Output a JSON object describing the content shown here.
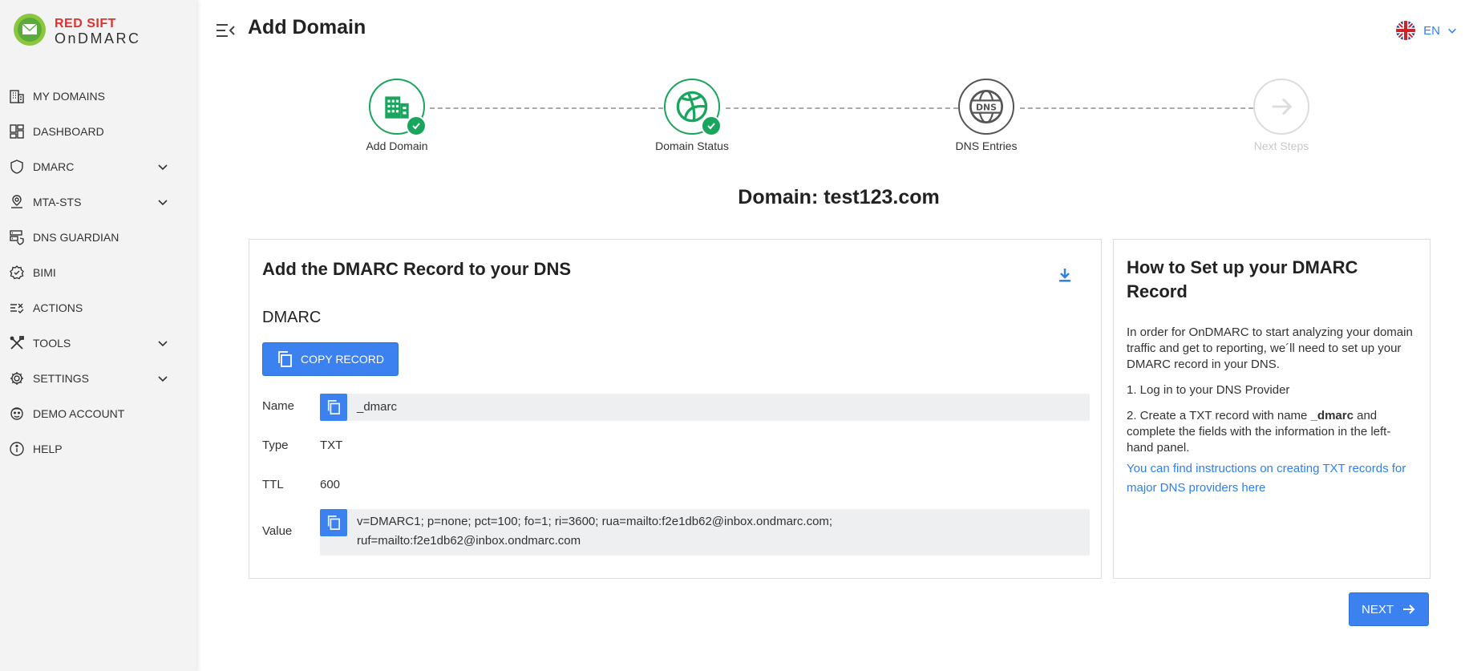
{
  "brand": {
    "line1": "RED SIFT",
    "line2": "OnDMARC"
  },
  "sidebar": {
    "items": [
      {
        "label": "MY DOMAINS",
        "icon": "building-icon"
      },
      {
        "label": "DASHBOARD",
        "icon": "dashboard-icon"
      },
      {
        "label": "DMARC",
        "icon": "shield-icon",
        "expandable": true
      },
      {
        "label": "MTA-STS",
        "icon": "map-pin-icon",
        "expandable": true
      },
      {
        "label": "DNS GUARDIAN",
        "icon": "server-shield-icon"
      },
      {
        "label": "BIMI",
        "icon": "badge-check-icon"
      },
      {
        "label": "ACTIONS",
        "icon": "checklist-icon"
      },
      {
        "label": "TOOLS",
        "icon": "tools-icon",
        "expandable": true
      },
      {
        "label": "SETTINGS",
        "icon": "gear-icon",
        "expandable": true
      },
      {
        "label": "DEMO ACCOUNT",
        "icon": "user-icon"
      },
      {
        "label": "HELP",
        "icon": "info-icon"
      }
    ]
  },
  "header": {
    "title": "Add Domain",
    "language": "EN"
  },
  "stepper": {
    "steps": [
      {
        "label": "Add Domain",
        "status": "complete"
      },
      {
        "label": "Domain Status",
        "status": "complete"
      },
      {
        "label": "DNS Entries",
        "status": "current"
      },
      {
        "label": "Next Steps",
        "status": "upcoming"
      }
    ],
    "dns_badge": "DNS"
  },
  "domain_heading": "Domain: test123.com",
  "record_card": {
    "title": "Add the DMARC Record to your DNS",
    "section": "DMARC",
    "copy_button": "COPY RECORD",
    "fields": {
      "name_label": "Name",
      "name_value": "_dmarc",
      "type_label": "Type",
      "type_value": "TXT",
      "ttl_label": "TTL",
      "ttl_value": "600",
      "value_label": "Value",
      "value_line1": "v=DMARC1; p=none; pct=100; fo=1; ri=3600; rua=mailto:f2e1db62@inbox.ondmarc.com;",
      "value_line2": "ruf=mailto:f2e1db62@inbox.ondmarc.com"
    }
  },
  "help_card": {
    "title": "How to Set up your DMARC Record",
    "intro": "In order for OnDMARC to start analyzing your domain traffic and get to reporting, we´ll need to set up your DMARC record in your DNS.",
    "step1": "1. Log in to your DNS Provider",
    "step2_prefix": "2. Create a TXT record with name ",
    "step2_bold": "_dmarc",
    "step2_suffix": " and complete the fields with the information in the left-hand panel.",
    "link": "You can find instructions on creating TXT records for major DNS providers here"
  },
  "next_button": "NEXT",
  "colors": {
    "primary": "#3b82f0",
    "success": "#1aa55f",
    "link": "#2f80ed",
    "brand_red": "#e0312d"
  }
}
